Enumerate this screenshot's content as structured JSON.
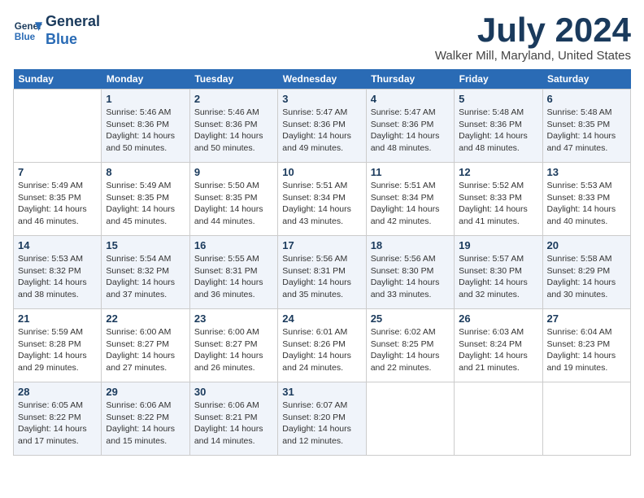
{
  "header": {
    "logo_line1": "General",
    "logo_line2": "Blue",
    "month": "July 2024",
    "location": "Walker Mill, Maryland, United States"
  },
  "weekdays": [
    "Sunday",
    "Monday",
    "Tuesday",
    "Wednesday",
    "Thursday",
    "Friday",
    "Saturday"
  ],
  "weeks": [
    [
      {
        "day": "",
        "text": ""
      },
      {
        "day": "1",
        "text": "Sunrise: 5:46 AM\nSunset: 8:36 PM\nDaylight: 14 hours\nand 50 minutes."
      },
      {
        "day": "2",
        "text": "Sunrise: 5:46 AM\nSunset: 8:36 PM\nDaylight: 14 hours\nand 50 minutes."
      },
      {
        "day": "3",
        "text": "Sunrise: 5:47 AM\nSunset: 8:36 PM\nDaylight: 14 hours\nand 49 minutes."
      },
      {
        "day": "4",
        "text": "Sunrise: 5:47 AM\nSunset: 8:36 PM\nDaylight: 14 hours\nand 48 minutes."
      },
      {
        "day": "5",
        "text": "Sunrise: 5:48 AM\nSunset: 8:36 PM\nDaylight: 14 hours\nand 48 minutes."
      },
      {
        "day": "6",
        "text": "Sunrise: 5:48 AM\nSunset: 8:35 PM\nDaylight: 14 hours\nand 47 minutes."
      }
    ],
    [
      {
        "day": "7",
        "text": "Sunrise: 5:49 AM\nSunset: 8:35 PM\nDaylight: 14 hours\nand 46 minutes."
      },
      {
        "day": "8",
        "text": "Sunrise: 5:49 AM\nSunset: 8:35 PM\nDaylight: 14 hours\nand 45 minutes."
      },
      {
        "day": "9",
        "text": "Sunrise: 5:50 AM\nSunset: 8:35 PM\nDaylight: 14 hours\nand 44 minutes."
      },
      {
        "day": "10",
        "text": "Sunrise: 5:51 AM\nSunset: 8:34 PM\nDaylight: 14 hours\nand 43 minutes."
      },
      {
        "day": "11",
        "text": "Sunrise: 5:51 AM\nSunset: 8:34 PM\nDaylight: 14 hours\nand 42 minutes."
      },
      {
        "day": "12",
        "text": "Sunrise: 5:52 AM\nSunset: 8:33 PM\nDaylight: 14 hours\nand 41 minutes."
      },
      {
        "day": "13",
        "text": "Sunrise: 5:53 AM\nSunset: 8:33 PM\nDaylight: 14 hours\nand 40 minutes."
      }
    ],
    [
      {
        "day": "14",
        "text": "Sunrise: 5:53 AM\nSunset: 8:32 PM\nDaylight: 14 hours\nand 38 minutes."
      },
      {
        "day": "15",
        "text": "Sunrise: 5:54 AM\nSunset: 8:32 PM\nDaylight: 14 hours\nand 37 minutes."
      },
      {
        "day": "16",
        "text": "Sunrise: 5:55 AM\nSunset: 8:31 PM\nDaylight: 14 hours\nand 36 minutes."
      },
      {
        "day": "17",
        "text": "Sunrise: 5:56 AM\nSunset: 8:31 PM\nDaylight: 14 hours\nand 35 minutes."
      },
      {
        "day": "18",
        "text": "Sunrise: 5:56 AM\nSunset: 8:30 PM\nDaylight: 14 hours\nand 33 minutes."
      },
      {
        "day": "19",
        "text": "Sunrise: 5:57 AM\nSunset: 8:30 PM\nDaylight: 14 hours\nand 32 minutes."
      },
      {
        "day": "20",
        "text": "Sunrise: 5:58 AM\nSunset: 8:29 PM\nDaylight: 14 hours\nand 30 minutes."
      }
    ],
    [
      {
        "day": "21",
        "text": "Sunrise: 5:59 AM\nSunset: 8:28 PM\nDaylight: 14 hours\nand 29 minutes."
      },
      {
        "day": "22",
        "text": "Sunrise: 6:00 AM\nSunset: 8:27 PM\nDaylight: 14 hours\nand 27 minutes."
      },
      {
        "day": "23",
        "text": "Sunrise: 6:00 AM\nSunset: 8:27 PM\nDaylight: 14 hours\nand 26 minutes."
      },
      {
        "day": "24",
        "text": "Sunrise: 6:01 AM\nSunset: 8:26 PM\nDaylight: 14 hours\nand 24 minutes."
      },
      {
        "day": "25",
        "text": "Sunrise: 6:02 AM\nSunset: 8:25 PM\nDaylight: 14 hours\nand 22 minutes."
      },
      {
        "day": "26",
        "text": "Sunrise: 6:03 AM\nSunset: 8:24 PM\nDaylight: 14 hours\nand 21 minutes."
      },
      {
        "day": "27",
        "text": "Sunrise: 6:04 AM\nSunset: 8:23 PM\nDaylight: 14 hours\nand 19 minutes."
      }
    ],
    [
      {
        "day": "28",
        "text": "Sunrise: 6:05 AM\nSunset: 8:22 PM\nDaylight: 14 hours\nand 17 minutes."
      },
      {
        "day": "29",
        "text": "Sunrise: 6:06 AM\nSunset: 8:22 PM\nDaylight: 14 hours\nand 15 minutes."
      },
      {
        "day": "30",
        "text": "Sunrise: 6:06 AM\nSunset: 8:21 PM\nDaylight: 14 hours\nand 14 minutes."
      },
      {
        "day": "31",
        "text": "Sunrise: 6:07 AM\nSunset: 8:20 PM\nDaylight: 14 hours\nand 12 minutes."
      },
      {
        "day": "",
        "text": ""
      },
      {
        "day": "",
        "text": ""
      },
      {
        "day": "",
        "text": ""
      }
    ]
  ]
}
